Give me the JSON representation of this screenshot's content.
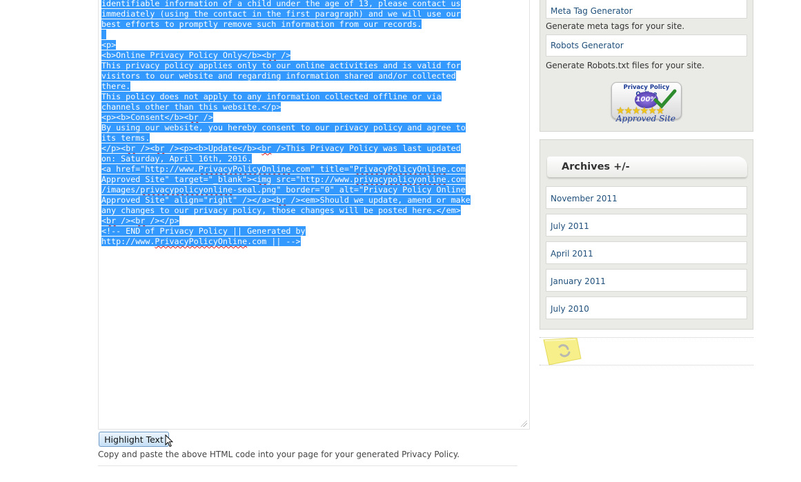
{
  "code_lines": [
    "identifiable information of a child under the age of 13, please contact us",
    "immediately (using the contact in the first paragraph) and we will use our",
    "best efforts to promptly remove such information from our records.",
    "",
    "<p>",
    "<b>Online Privacy Policy Only</b><br />",
    "This privacy policy applies only to our online activities and is valid for",
    "visitors to our website and regarding information shared and/or collected",
    "there.",
    "This policy does not apply to any information collected offline or via",
    "channels other than this website.</p>",
    "<p><b>Consent</b><br />",
    "By using our website, you hereby consent to our privacy policy and agree to",
    "its terms.",
    "</p><br /><br /><p><b>Update</b><br />This Privacy Policy was last updated",
    "on: Saturday, April 16th, 2016.",
    "<a href=\"http://www.PrivacyPolicyOnline.com\" title=\"PrivacyPolicyOnline.com",
    "Approved Site\" target=\"_blank\"><img src=\"http://www.privacypolicyonline.com",
    "/images/privacypolicyonline-seal.png\" border=\"0\" alt=\"Privacy Policy Online",
    "Approved Site\" align=\"right\" /></a><br /><em>Should we update, amend or make",
    "any changes to our privacy policy, those changes will be posted here.</em>",
    "<br /><br /></p>",
    "<!-- END of Privacy Policy || Generated by",
    "http://www.PrivacyPolicyOnline.com || -->"
  ],
  "highlight_button_label": "Highlight Text",
  "help_text": "Copy and paste the above HTML code into your page for your generated Privacy Policy.",
  "tools_widget": {
    "links": [
      {
        "label": "Meta Tag Generator",
        "description": "Generate meta tags for your site."
      },
      {
        "label": "Robots Generator",
        "description": "Generate Robots.txt files for your site."
      }
    ],
    "seal": {
      "top_text": "Privacy Policy Online",
      "percent": "100%",
      "bottom_text": "Approved Site"
    }
  },
  "archives_widget": {
    "title": "Archives +/-",
    "items": [
      "November 2011",
      "July 2011",
      "April 2011",
      "January 2011",
      "July 2010"
    ]
  },
  "colors": {
    "selection": "#3399ff",
    "link": "#1f4f7a",
    "widget_bg": "#eaeae6"
  },
  "icons": {
    "loader": "refresh-spinner-icon",
    "cursor": "mouse-pointer-icon",
    "check": "checkmark-icon",
    "stars": "star-icon"
  }
}
